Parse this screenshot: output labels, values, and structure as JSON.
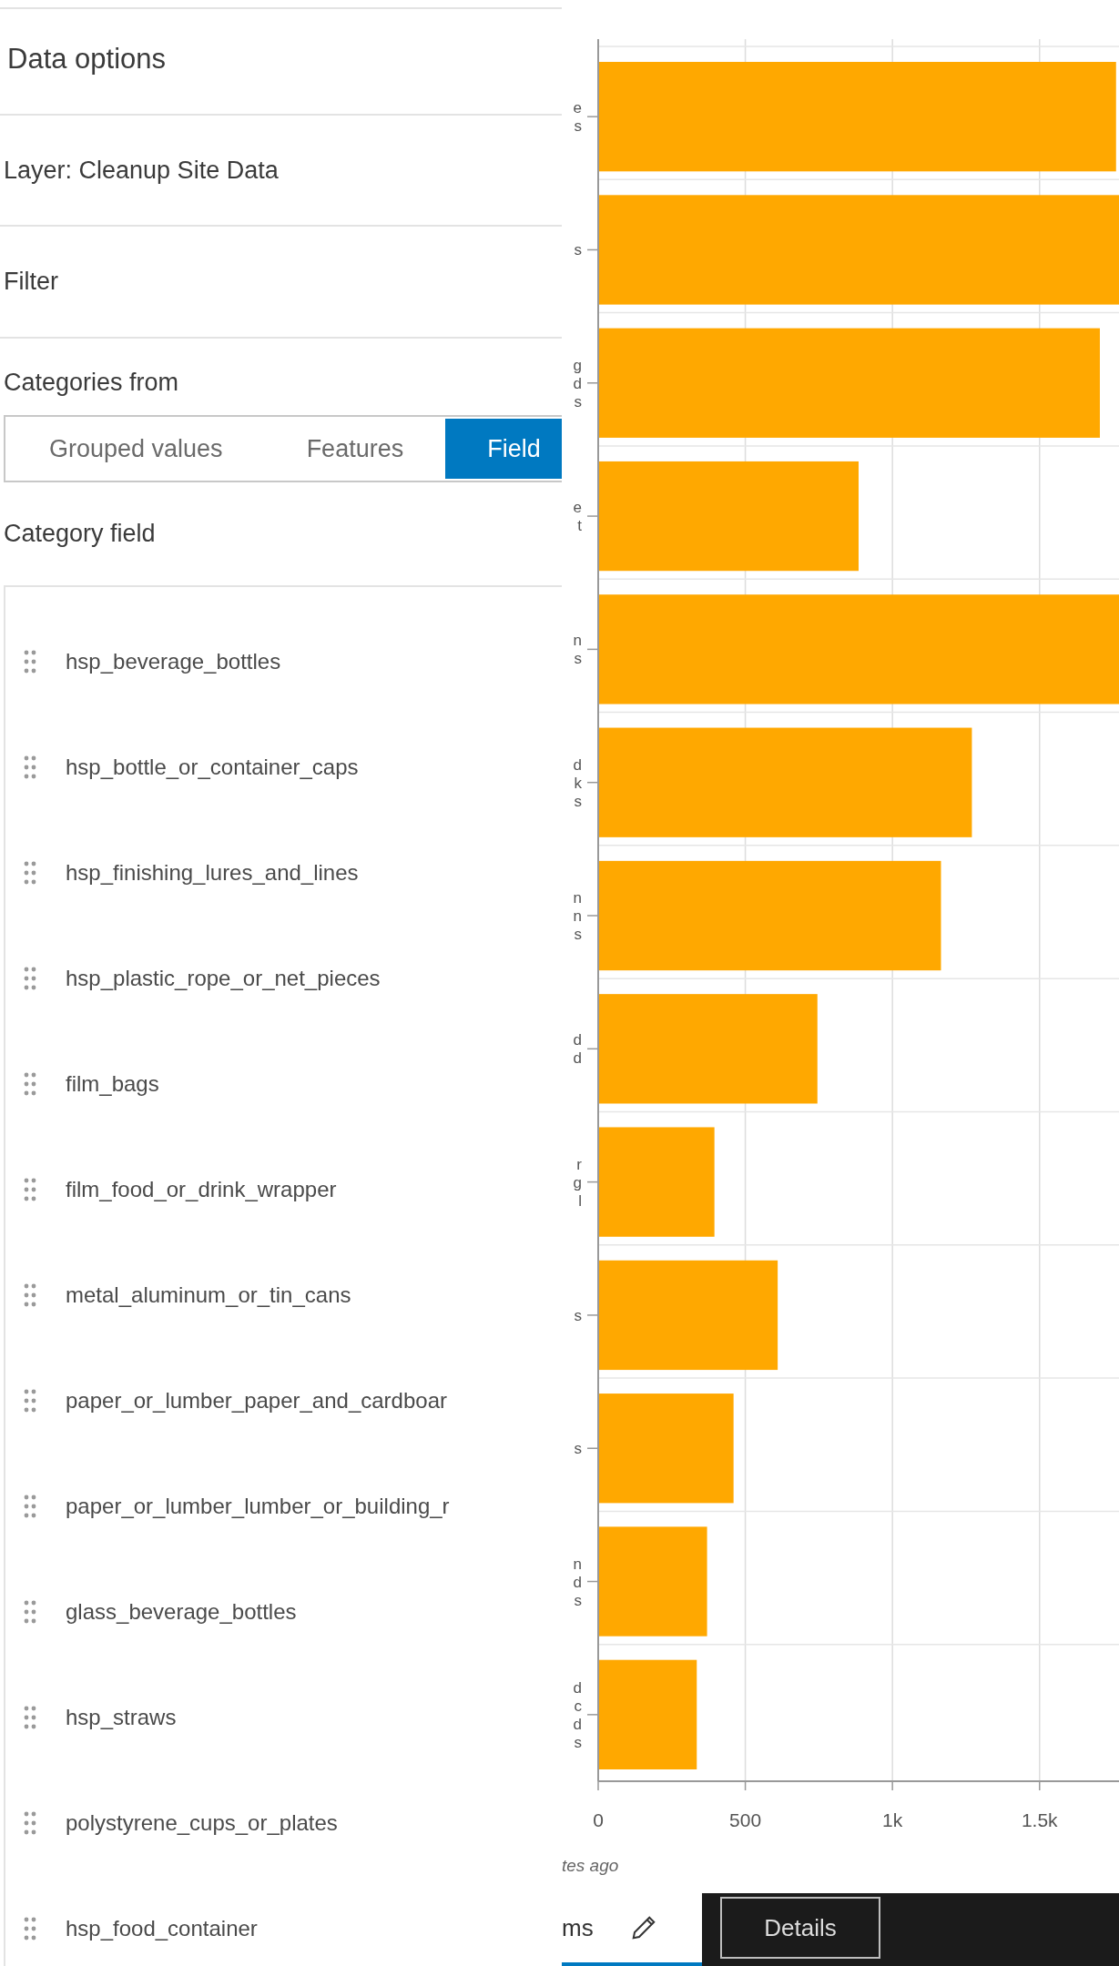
{
  "panel": {
    "title": "Data options",
    "layer": "Layer: Cleanup Site Data",
    "filter": "Filter",
    "categories_label": "Categories from",
    "segments": [
      {
        "label": "Grouped values",
        "selected": false
      },
      {
        "label": "Features",
        "selected": false
      },
      {
        "label": "Field",
        "selected": true
      }
    ],
    "category_field_label": "Category field",
    "fields": [
      "hsp_beverage_bottles",
      "hsp_bottle_or_container_caps",
      "hsp_finishing_lures_and_lines",
      "hsp_plastic_rope_or_net_pieces",
      "film_bags",
      "film_food_or_drink_wrapper",
      "metal_aluminum_or_tin_cans",
      "paper_or_lumber_paper_and_cardboar",
      "paper_or_lumber_lumber_or_building_r",
      "glass_beverage_bottles",
      "hsp_straws",
      "polystyrene_cups_or_plates",
      "hsp_food_container"
    ]
  },
  "chart": {
    "chart_data": {
      "type": "bar",
      "orientation": "horizontal",
      "categories": [
        "e\ns",
        "s",
        "g\nd\ns",
        "e\nt",
        "n\ns",
        "d\nk\ns",
        "n\nn\ns",
        "d\nd",
        "r\ng\nl",
        "s",
        "s",
        "n\nd\ns",
        "d\nc\nd\ns"
      ],
      "series": [
        {
          "color": "#ffa800",
          "values": [
            1760,
            1770,
            1705,
            885,
            1770,
            1270,
            1165,
            745,
            395,
            610,
            460,
            370,
            335
          ]
        }
      ],
      "grid": true,
      "xlim": [
        0,
        1770
      ],
      "xticks": [
        0,
        500,
        {
          "value": 1000,
          "label": "1k"
        },
        {
          "value": 1500,
          "label": "1.5k"
        }
      ]
    }
  },
  "updated": "tes ago",
  "tabs": [
    {
      "label": "ms",
      "selected": true
    },
    {
      "label": "Details",
      "selected": false
    }
  ]
}
